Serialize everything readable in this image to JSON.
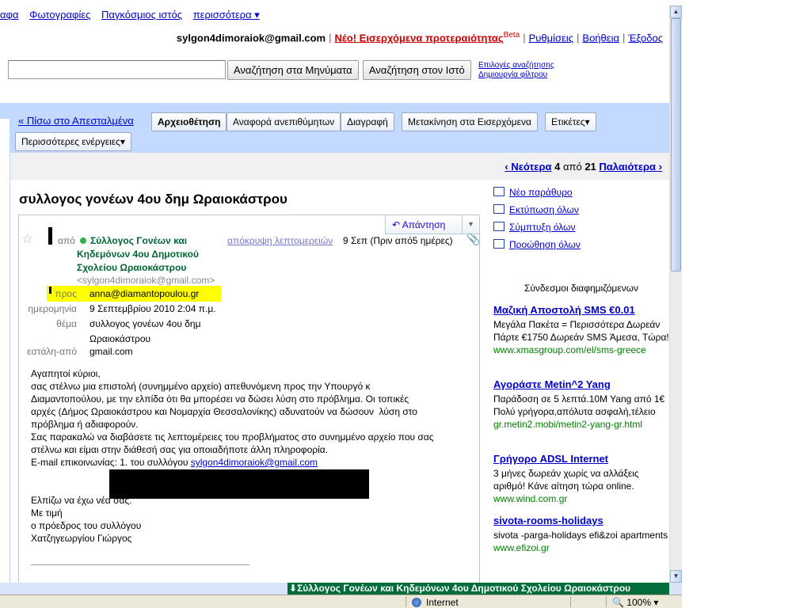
{
  "topnav": {
    "items": [
      "αφα",
      "Φωτογραφίες",
      "Παγκόσμιος ιστός"
    ],
    "more": "περισσότερα ▾"
  },
  "account": {
    "email": "sylgon4dimoraiok@gmail.com",
    "new_feature": "Νέο! Εισερχόμενα προτεραιότητας",
    "beta": "Beta",
    "settings": "Ρυθμίσεις",
    "help": "Βοήθεια",
    "logout": "Έξοδος"
  },
  "search": {
    "value": "",
    "search_mail": "Αναζήτηση στα Μηνύματα",
    "search_web": "Αναζήτηση στον Ιστό",
    "options": "Επιλογές αναζήτησης",
    "create_filter": "Δημιουργία φίλτρου"
  },
  "toolbar": {
    "back": "« Πίσω στο Απεσταλμένα",
    "archive": "Αρχειοθέτηση",
    "report": "Αναφορά ανεπιθύμητων",
    "delete": "Διαγραφή",
    "move": "Μετακίνηση στα Εισερχόμενα",
    "labels": "Ετικέτες▾",
    "more_actions": "Περισσότερες ενέργειες▾"
  },
  "pagination": {
    "newer": "‹ Νεότερα",
    "current": "4",
    "of": "από",
    "total": "21",
    "older": "Παλαιότερα ›"
  },
  "message": {
    "subject": "συλλογος γονέων 4ου δημ Ωραιοκάστρου",
    "reply": "Απάντηση",
    "from_label": "από",
    "from_name": "Σύλλογος Γονέων και Κηδεμόνων 4ου Δημοτικού Σχολείου Ωραιοκάστρου",
    "from_email": "<sylgon4dimoraiok@gmail.com>",
    "hide_details": "απόκρυψη λεπτομερειών",
    "date_short": "9 Σεπ (Πριν από5 ημέρες)",
    "to_label": "προς",
    "to_value": "anna@diamantopoulou.gr",
    "date_label": "ημερομηνία",
    "date_value": "9 Σεπτεμβρίου 2010 2:04 π.μ.",
    "subject_label": "θέμα",
    "subject_value_1": "συλλογος γονέων 4ου δημ",
    "subject_value_2": "Ωραιοκάστρου",
    "mailed_by_label": "εστάλη-από",
    "mailed_by_value": "gmail.com",
    "body": [
      "Αγαπητοί κύριοι,",
      "σας στέλνω μια επιστολή (συνημμένο αρχείο) απεθυνόμενη προς την Υπουργό κ",
      "Διαμαντοπούλου, με την ελπίδα ότι θα μπορέσει να δώσει λύση στο πρόβλημα. Οι τοπικές",
      "αρχές (Δήμος Ωραιοκάστρου και Νομαρχία Θεσσαλονίκης) αδυνατούν να δώσουν  λύση στο",
      "πρόβλημα ή αδιαφορούν.",
      "Σας παρακαλώ να διαβάσετε τις λεπτομέρειες του προβλήματος στο συνημμένο αρχείο που σας",
      "στέλνω και είμαι στην διάθεσή σας για οποιαδήποτε άλλη πληροφορία."
    ],
    "contact_prefix": "E-mail επικοινωνίας: 1. του συλλόγου ",
    "contact_email": "sylgon4dimoraiok@gmail.com",
    "closing": [
      "Ελπίζω να έχω νέα σας.",
      "Με τιμή",
      "ο πρόεδρος του συλλόγου",
      "Χατζηγεωργίου Γιώργος"
    ]
  },
  "side_actions": {
    "new_window": "Νέο παράθυρο",
    "print_all": "Εκτύπωση όλων",
    "collapse_all": "Σύμπτυξη όλων",
    "forward_all": "Προώθηση όλων"
  },
  "ads": {
    "title": "Σύνδεσμοι διαφημιζόμενων",
    "items": [
      {
        "title": "Μαζική Αποστολή SMS €0.01",
        "text": "Μεγάλα Πακέτα = Περισσότερα Δωρεάν Πάρτε €1750 Δωρεάν SMS Άμεσα, Τώρα!",
        "url": "www.xmasgroup.com/el/sms-greece"
      },
      {
        "title": "Αγοράστε Metin^2 Yang",
        "text": "Παράδοση σε 5 λεπτά.10M Yang από 1€ Πολύ γρήγορα,απόλυτα ασφαλή,τέλειο",
        "url": "gr.metin2.mobi/metin2-yang-gr.html"
      },
      {
        "title": "Γρήγορο ADSL Internet",
        "text": "3 μήνες δωρεάν χωρίς να αλλάξεις αριθμό! Κάνε αίτηση τώρα online.",
        "url": "www.wind.com.gr"
      },
      {
        "title": "sivota-rooms-holidays",
        "text": "sivota -parga-holidays efi&zoi apartments",
        "url": "www.efizoi.gr"
      }
    ]
  },
  "download": {
    "label": "Σύλλογος Γονέων και Κηδεμόνων 4ου Δημοτικού Σχολείου Ωραιοκάστρου"
  },
  "statusbar": {
    "zone": "Internet",
    "zoom": "100%"
  },
  "colors": {
    "toolbar_bg": "#c3d9ff",
    "link": "#0000cc",
    "sender_green": "#006633",
    "ad_url_green": "#008000",
    "highlight": "#ffff00"
  }
}
